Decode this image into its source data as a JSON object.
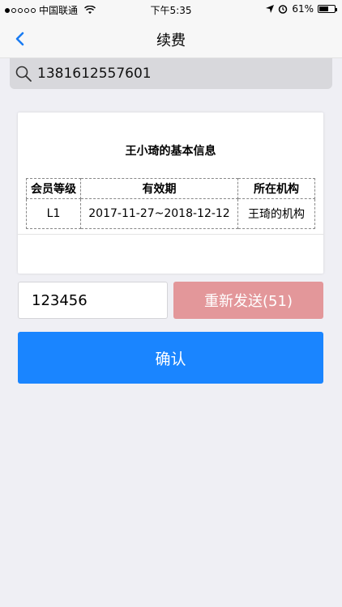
{
  "status_bar": {
    "carrier": "中国联通",
    "time": "下午5:35",
    "battery": "61%",
    "battery_level": 0.61,
    "icons": [
      "signal-dots-icon",
      "wifi-icon",
      "location-arrow-icon",
      "alarm-icon",
      "battery-icon"
    ]
  },
  "nav": {
    "title": "续费",
    "back_icon": "chevron-left-icon",
    "accent": "#1a7cf2"
  },
  "search": {
    "icon": "search-icon",
    "value": "1381612557601"
  },
  "info_card": {
    "title": "王小琦的基本信息",
    "columns": [
      "会员等级",
      "有效期",
      "所在机构"
    ],
    "rows": [
      [
        "L1",
        "2017-11-27~2018-12-12",
        "王琦的机构"
      ]
    ]
  },
  "verify": {
    "code_value": "123456",
    "resend_label": "重新发送(51)",
    "resend_color": "#e3979a"
  },
  "confirm": {
    "label": "确认",
    "color": "#1a85ff"
  }
}
